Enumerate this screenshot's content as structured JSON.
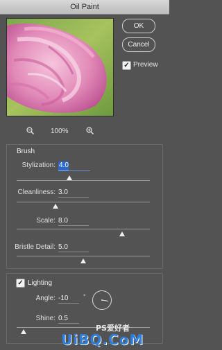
{
  "window": {
    "title": "Oil Paint"
  },
  "buttons": {
    "ok": "OK",
    "cancel": "Cancel"
  },
  "preview_toggle": {
    "label": "Preview",
    "checked": true
  },
  "zoom": {
    "out_icon": "zoom-out-icon",
    "level": "100%",
    "in_icon": "zoom-in-icon"
  },
  "brush": {
    "title": "Brush",
    "stylization": {
      "label": "Stylization:",
      "value": "4.0",
      "fraction": 0.4
    },
    "cleanliness": {
      "label": "Cleanliness:",
      "value": "3.0",
      "fraction": 0.3
    },
    "scale": {
      "label": "Scale:",
      "value": "8.0",
      "fraction": 0.8
    },
    "bristle": {
      "label": "Bristle Detail:",
      "value": "5.0",
      "fraction": 0.5
    }
  },
  "lighting": {
    "title": "Lighting",
    "checked": true,
    "angle": {
      "label": "Angle:",
      "value": "-10",
      "unit": "°"
    },
    "shine": {
      "label": "Shine:",
      "value": "0.5",
      "fraction": 0.05
    }
  },
  "watermark": {
    "text1": "PS爱好者",
    "text2": "UiBQ.CoM"
  }
}
